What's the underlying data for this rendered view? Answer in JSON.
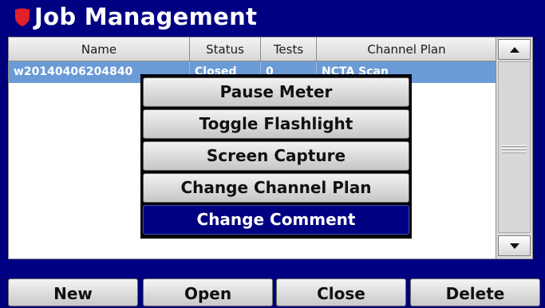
{
  "window": {
    "title": "Job Management",
    "accent": "#000083",
    "icon": "shield-icon",
    "icon_color": "#e0202a"
  },
  "table": {
    "columns": [
      "Name",
      "Status",
      "Tests",
      "Channel Plan"
    ],
    "selected_row": {
      "name": "w20140406204840",
      "status": "Closed",
      "tests": "0",
      "channel_plan": "NCTA Scan"
    },
    "selection_color": "#6b9bd6"
  },
  "scrollbar": {
    "up_icon": "arrow-up-icon",
    "down_icon": "arrow-down-icon"
  },
  "context_menu": {
    "items": [
      {
        "label": "Pause Meter",
        "active": false
      },
      {
        "label": "Toggle Flashlight",
        "active": false
      },
      {
        "label": "Screen Capture",
        "active": false
      },
      {
        "label": "Change Channel Plan",
        "active": false
      },
      {
        "label": "Change Comment",
        "active": true
      }
    ]
  },
  "softkeys": {
    "new_label": "New",
    "open_label": "Open",
    "close_label": "Close",
    "delete_label": "Delete"
  }
}
